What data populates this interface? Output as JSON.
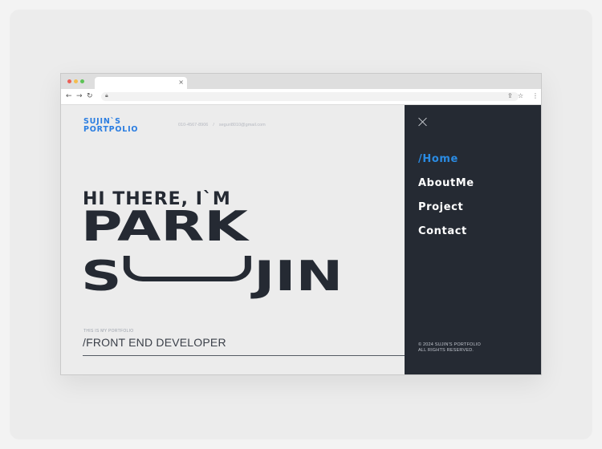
{
  "logo": {
    "line1": "SUJIN`S",
    "line2": "PORTPOLIO"
  },
  "contact": {
    "phone": "010-4567-8906",
    "separator": "/",
    "email": "seguri8010@gmail.com"
  },
  "hero": {
    "greeting": "HI THERE, I`M",
    "first_name": "PARK",
    "last_name_prefix": "S",
    "last_name_suffix": "JIN",
    "eyebrow": "THIS IS MY PORTFOLIO",
    "role": "/FRONT END DEVELOPER"
  },
  "menu": {
    "items": [
      {
        "label": "/Home",
        "active": true
      },
      {
        "label": "AboutMe",
        "active": false
      },
      {
        "label": "Project",
        "active": false
      },
      {
        "label": "Contact",
        "active": false
      }
    ],
    "footer_line1": "© 2024 SUJIN'S PORTFOLIO",
    "footer_line2": "ALL RIGHTS RESERVED."
  },
  "browser": {
    "tab_close": "×",
    "icons": {
      "back": "back-arrow-icon",
      "forward": "forward-arrow-icon",
      "reload": "reload-icon",
      "share": "share-icon",
      "star": "star-icon",
      "menu": "kebab-menu-icon"
    }
  },
  "colors": {
    "accent": "#2a8be3",
    "dark": "#252a33",
    "background": "#ececec"
  }
}
